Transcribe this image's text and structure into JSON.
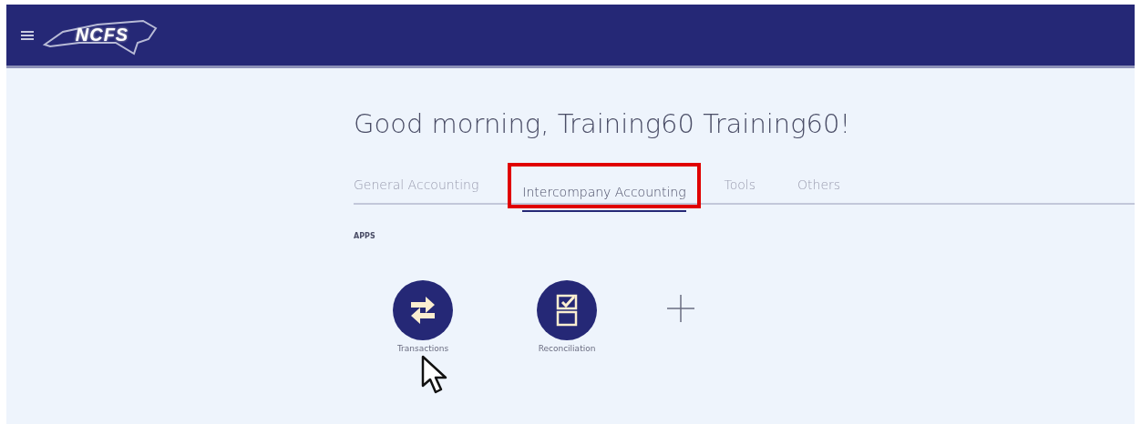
{
  "header": {
    "logo": "NCFS"
  },
  "greeting": "Good morning, Training60 Training60!",
  "tabs": [
    {
      "label": "General Accounting",
      "selected": false,
      "highlighted": false
    },
    {
      "label": "Intercompany Accounting",
      "selected": true,
      "highlighted": true
    },
    {
      "label": "Tools",
      "selected": false,
      "highlighted": false
    },
    {
      "label": "Others",
      "selected": false,
      "highlighted": false
    }
  ],
  "section_title": "APPS",
  "apps": [
    {
      "kind": "transfer",
      "label": "Transactions"
    },
    {
      "kind": "checklist",
      "label": "Reconciliation"
    },
    {
      "kind": "add"
    }
  ]
}
